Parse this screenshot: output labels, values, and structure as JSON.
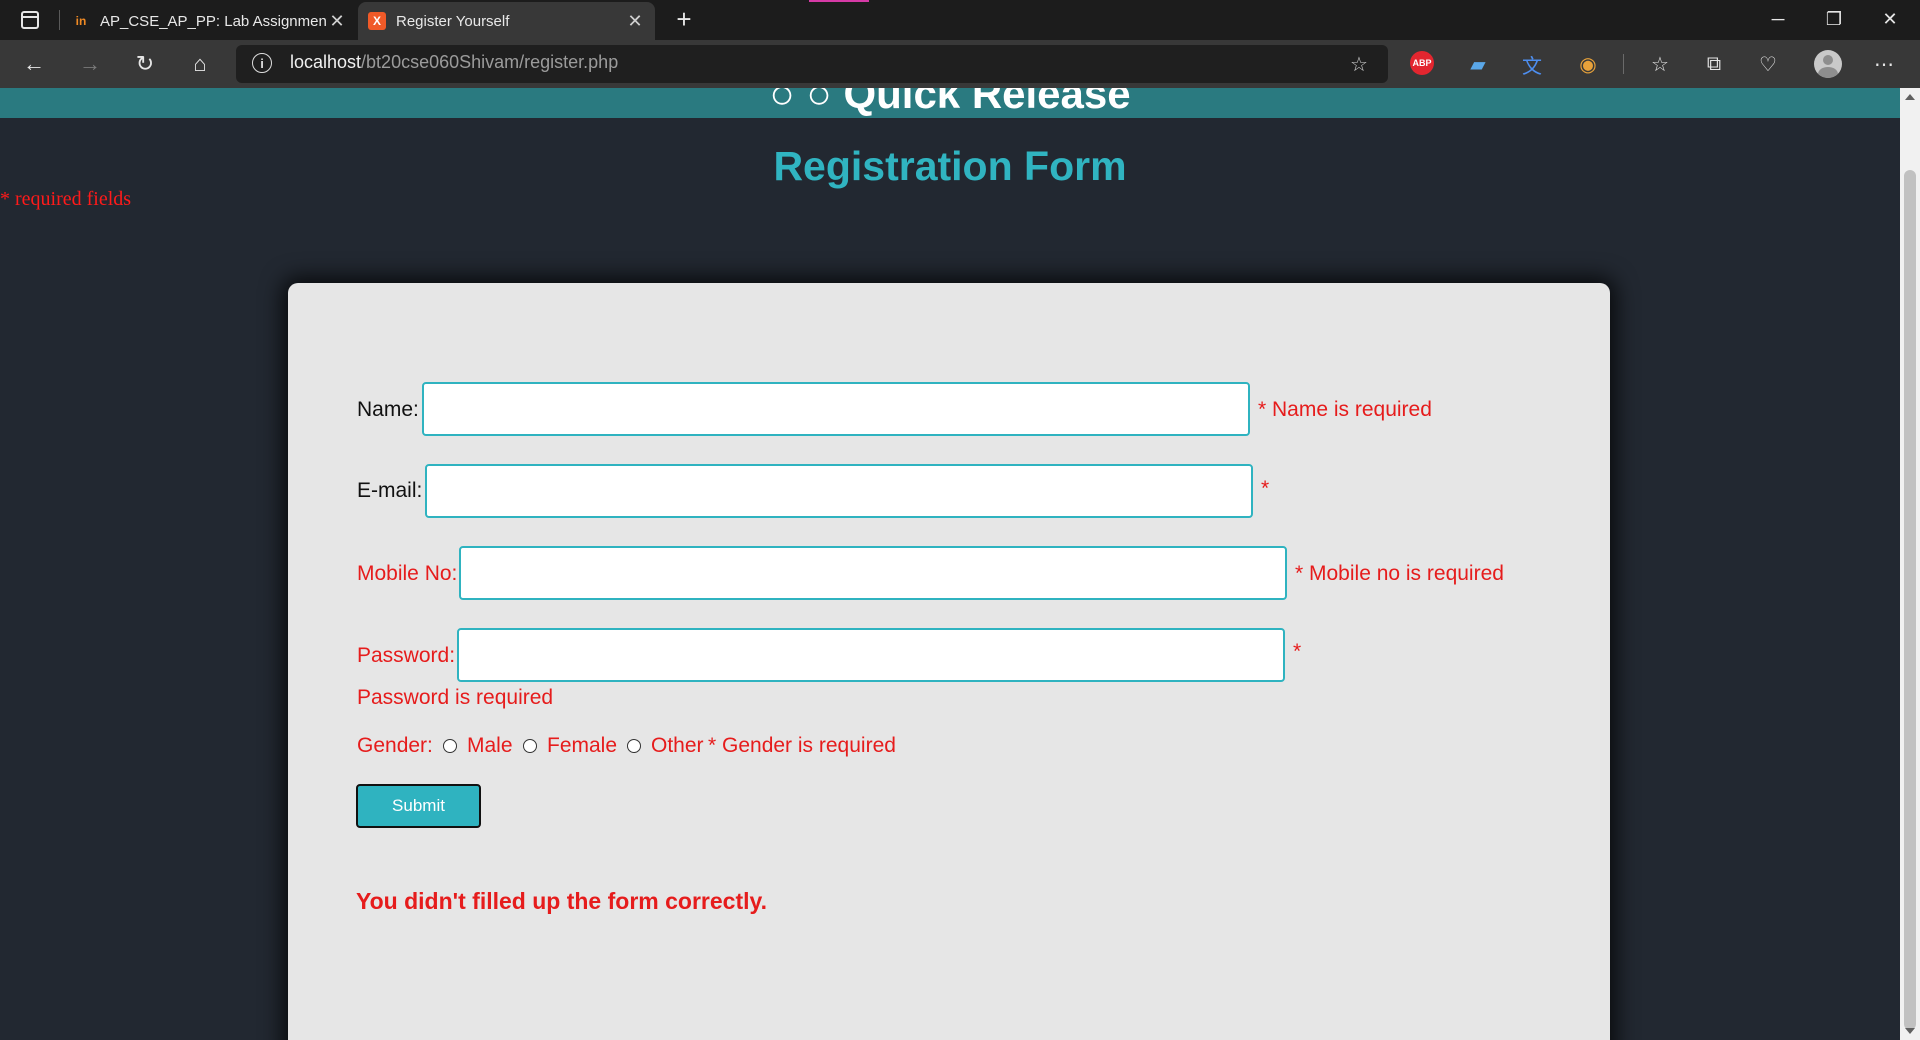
{
  "browser": {
    "tabs": [
      {
        "title": "AP_CSE_AP_PP: Lab Assignment",
        "favicon": "in"
      },
      {
        "title": "Register Yourself",
        "favicon": "X",
        "active": true
      }
    ],
    "url_host": "localhost",
    "url_path": "/bt20cse060Shivam/register.php",
    "extensions": [
      {
        "name": "adblock-plus-icon",
        "text": "ABP"
      }
    ]
  },
  "page": {
    "banner": "○ ○ Quick Release",
    "title": "Registration Form",
    "required_note": "* required fields"
  },
  "form": {
    "name_label": "Name:",
    "name_error": "* Name is required",
    "name_value": "",
    "email_label": "E-mail:",
    "email_error": "*",
    "email_value": "",
    "mobile_label": "Mobile No:",
    "mobile_error": "* Mobile no is required",
    "mobile_value": "",
    "password_label": "Password:",
    "password_error": "*",
    "password_error_line": "Password is required",
    "password_value": "",
    "gender_label": "Gender:",
    "gender_options": [
      "Male",
      "Female",
      "Other"
    ],
    "gender_error": "* Gender is required",
    "submit_label": "Submit",
    "result_message": "You didn't filled up the form correctly."
  },
  "colors": {
    "accent": "#2fb3c0",
    "error": "#e61c1c",
    "page_bg": "#222831",
    "card_bg": "#e6e6e6"
  }
}
